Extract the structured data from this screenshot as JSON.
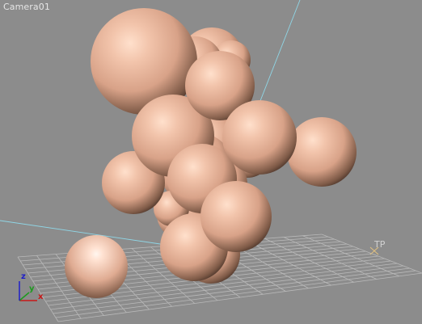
{
  "viewport": {
    "title": "Camera01",
    "target_label": "TP",
    "background_color": "#8c8c8c"
  },
  "axis_tripod": {
    "x": "x",
    "y": "y",
    "z": "z"
  },
  "colors": {
    "grid": "#b9b9b9",
    "camera_line": "#8fd6e6",
    "target_marker": "#e0c080",
    "sphere_highlight": "#ffe0cc",
    "sphere_base": "#d8a288",
    "sphere_shadow": "#0e0806",
    "axis_x": "#c81818",
    "axis_y": "#1e9a1e",
    "axis_z": "#1e1ec8"
  }
}
